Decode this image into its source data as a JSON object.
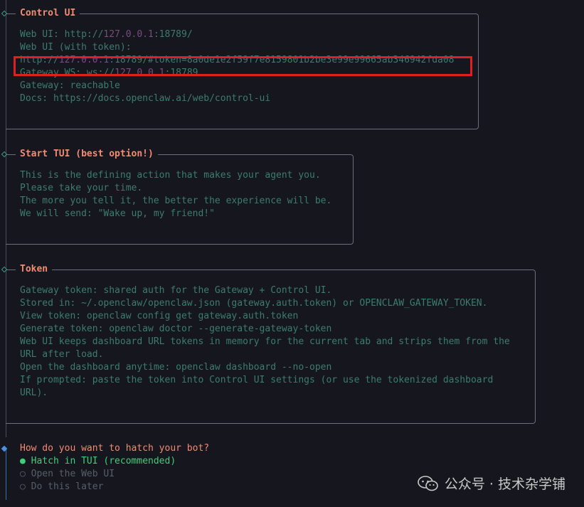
{
  "sections": [
    {
      "title": "Control UI",
      "lines": [
        "Web UI: http://127.0.0.1:18789/",
        "Web UI (with token):",
        "http://127.0.0.1:18789/#token=8a0de1e2f59f7e8159801b2be3e99e99665ab346942fda08",
        "Gateway WS: ws://127.0.0.1:18789",
        "Gateway: reachable",
        "Docs: https://docs.openclaw.ai/web/control-ui"
      ]
    },
    {
      "title": "Start TUI (best option!)",
      "lines": [
        "This is the defining action that makes your agent you.",
        "Please take your time.",
        "The more you tell it, the better the experience will be.",
        "We will send: \"Wake up, my friend!\""
      ]
    },
    {
      "title": "Token",
      "lines": [
        "Gateway token: shared auth for the Gateway + Control UI.",
        "Stored in: ~/.openclaw/openclaw.json (gateway.auth.token) or OPENCLAW_GATEWAY_TOKEN.",
        "View token: openclaw config get gateway.auth.token",
        "Generate token: openclaw doctor --generate-gateway-token",
        "Web UI keeps dashboard URL tokens in memory for the current tab and strips them from the URL after load.",
        "Open the dashboard anytime: openclaw dashboard --no-open",
        "If prompted: paste the token into Control UI settings (or use the tokenized dashboard URL)."
      ]
    }
  ],
  "prompt": {
    "question": "How do you want to hatch your bot?",
    "options": [
      {
        "label": "Hatch in TUI (recommended)",
        "marker": "●",
        "selected": true
      },
      {
        "label": "Open the Web UI",
        "marker": "○",
        "selected": false
      },
      {
        "label": "Do this later",
        "marker": "○",
        "selected": false
      }
    ]
  },
  "watermark": {
    "text": "公众号 · 技术杂学铺",
    "icon": "wechat-icon"
  },
  "colors": {
    "background": "#16161e",
    "title": "#f38b73",
    "text": "#3b7d6e",
    "selected": "#3ecf7a",
    "highlight": "#e02020"
  }
}
